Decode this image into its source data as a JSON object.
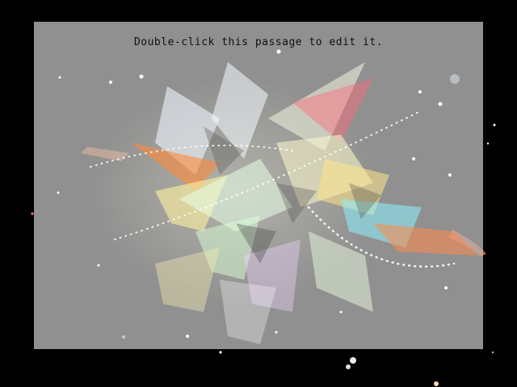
{
  "passage": {
    "text": "Double-click this passage to edit it."
  },
  "colors": {
    "background": "#000000",
    "panel": "#b9b9b9",
    "text": "#111111"
  }
}
